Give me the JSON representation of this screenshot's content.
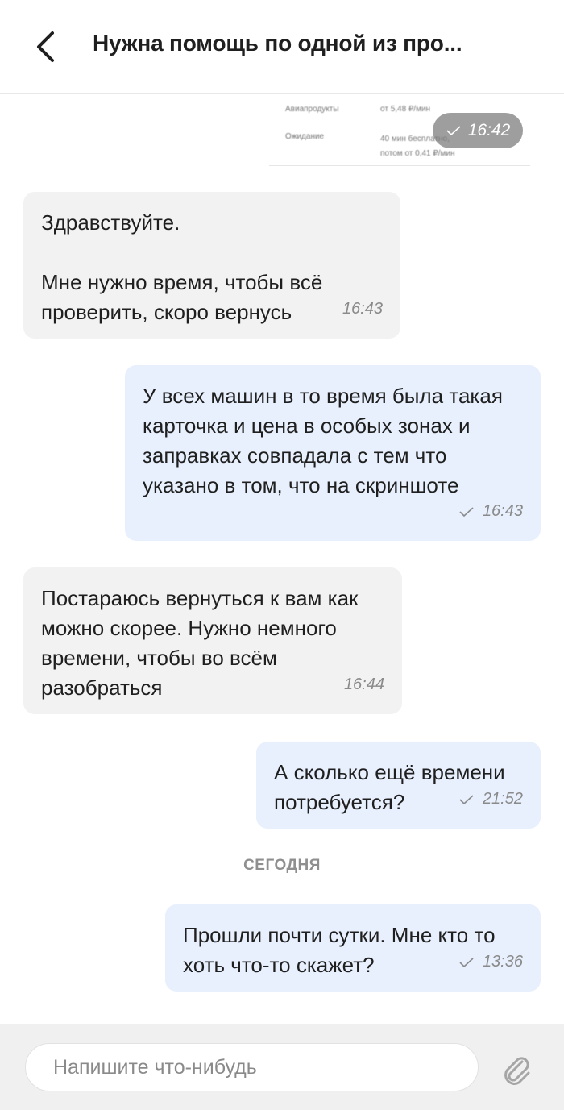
{
  "header": {
    "title": "Нужна помощь по одной из про..."
  },
  "preview": {
    "rows": [
      {
        "label": "Авиапродукты",
        "value": "от 5,48 ₽/мин"
      },
      {
        "label": "Ожидание",
        "value": "40 мин бесплатно,\nпотом от 0,41 ₽/мин"
      }
    ],
    "time": "16:42"
  },
  "messages": [
    {
      "direction": "incoming",
      "text": "Здравствуйте.\n\nМне нужно время, чтобы всё\nпроверить, скоро вернусь",
      "time": "16:43"
    },
    {
      "direction": "outgoing",
      "text": "У всех машин в то время была такая\nкарточка и цена в особых зонах и\nзаправках совпадала с тем что\nуказано в том, что на скриншоте",
      "time": "16:43"
    },
    {
      "direction": "incoming",
      "text": "Постараюсь вернуться к вам как\nможно скорее. Нужно немного\nвремени, чтобы во всём\nразобраться",
      "time": "16:44"
    },
    {
      "direction": "outgoing",
      "text": "А сколько ещё времени\nпотребуется?",
      "time": "21:52"
    },
    {
      "direction": "outgoing",
      "text": "Прошли почти сутки. Мне кто то\nхоть что-то скажет?",
      "time": "13:36"
    }
  ],
  "day_separator": "СЕГОДНЯ",
  "composer": {
    "placeholder": "Напишите что-нибудь"
  },
  "icons": {
    "back": "chevron-left-icon",
    "check": "check-icon",
    "attach": "paperclip-icon"
  },
  "colors": {
    "incoming_bubble": "#f2f2f2",
    "outgoing_bubble": "#e8f0fd",
    "composer_bar": "#f0f0f0"
  }
}
